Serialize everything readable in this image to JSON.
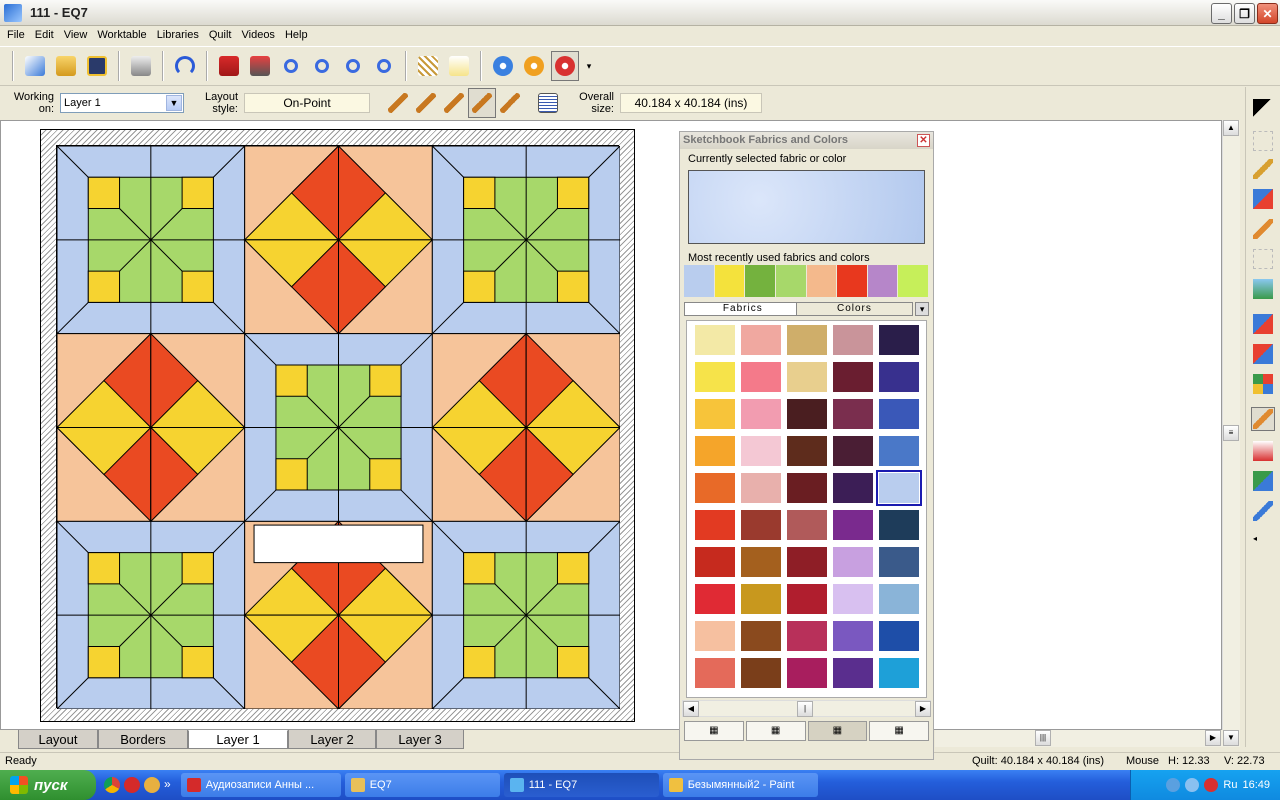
{
  "window": {
    "title": "111 - EQ7",
    "min": "_",
    "max": "❐",
    "close": "✕"
  },
  "menu": [
    "File",
    "Edit",
    "View",
    "Worktable",
    "Libraries",
    "Quilt",
    "Videos",
    "Help"
  ],
  "layoutbar": {
    "working_on_label": "Working on:",
    "working_on_value": "Layer 1",
    "layout_style_label": "Layout style:",
    "layout_style_value": "On-Point",
    "overall_size_label": "Overall size:",
    "overall_size_value": "40.184 x 40.184 (ins)"
  },
  "tabs": [
    {
      "label": "Layout",
      "active": false
    },
    {
      "label": "Borders",
      "active": false
    },
    {
      "label": "Layer 1",
      "active": true
    },
    {
      "label": "Layer 2",
      "active": false
    },
    {
      "label": "Layer 3",
      "active": false
    }
  ],
  "status": {
    "ready": "Ready",
    "quilt": "Quilt: 40.184 x 40.184 (ins)",
    "mouse": "Mouse",
    "h": "H: 12.33",
    "v": "V: 22.73"
  },
  "sketchbook": {
    "title": "Sketchbook Fabrics and Colors",
    "current_label": "Currently selected fabric or color",
    "recent_label": "Most recently used fabrics and colors",
    "recent_colors": [
      "#b9cdee",
      "#f4e23c",
      "#74b23e",
      "#a7d86a",
      "#f4b98c",
      "#e8381e",
      "#b686c9",
      "#c6ef5a"
    ],
    "tab_fabrics": "Fabrics",
    "tab_colors": "Colors",
    "selected_index": 24,
    "swatches": [
      "#f3e9a6",
      "#f0a8a0",
      "#cfae6a",
      "#c9949a",
      "#2a1e4a",
      "#f6e34a",
      "#f47a8a",
      "#e8cf8e",
      "#6a1e30",
      "#38308e",
      "#f7c43a",
      "#f29cb0",
      "#4a1e20",
      "#7a2e4e",
      "#3a58b8",
      "#f5a52a",
      "#f4c8d4",
      "#5e2c1c",
      "#4a1e34",
      "#4a78c8",
      "#e86a28",
      "#e8b0ac",
      "#6a1e22",
      "#3c1e56",
      "#b9cdee",
      "#e23a22",
      "#9a3a2e",
      "#b05a5a",
      "#7a2a8e",
      "#1e3c5a",
      "#c62a1e",
      "#a4601e",
      "#8e1e26",
      "#c8a0e0",
      "#3a5a8a",
      "#e02a34",
      "#c8981e",
      "#b01e2e",
      "#d8c0f0",
      "#8ab4d8",
      "#f6c0a0",
      "#8a4a1e",
      "#b8305a",
      "#7a58c0",
      "#1e4ea8",
      "#e46a5a",
      "#7a3e1a",
      "#a81e5e",
      "#5a2e8e",
      "#1ea0d8"
    ],
    "views": [
      "▦",
      "▦",
      "▦",
      "▦"
    ]
  },
  "taskbar": {
    "start": "пуск",
    "more": "»",
    "tasks": [
      {
        "label": "Аудиозаписи Анны ...",
        "color": "#d42a2a"
      },
      {
        "label": "EQ7",
        "color": "#e8c05a"
      },
      {
        "label": "111 - EQ7",
        "color": "#5ab4f0",
        "active": true
      },
      {
        "label": "Безымянный2 - Paint",
        "color": "#f0c040"
      }
    ],
    "lang": "Ru",
    "clock": "16:49"
  }
}
